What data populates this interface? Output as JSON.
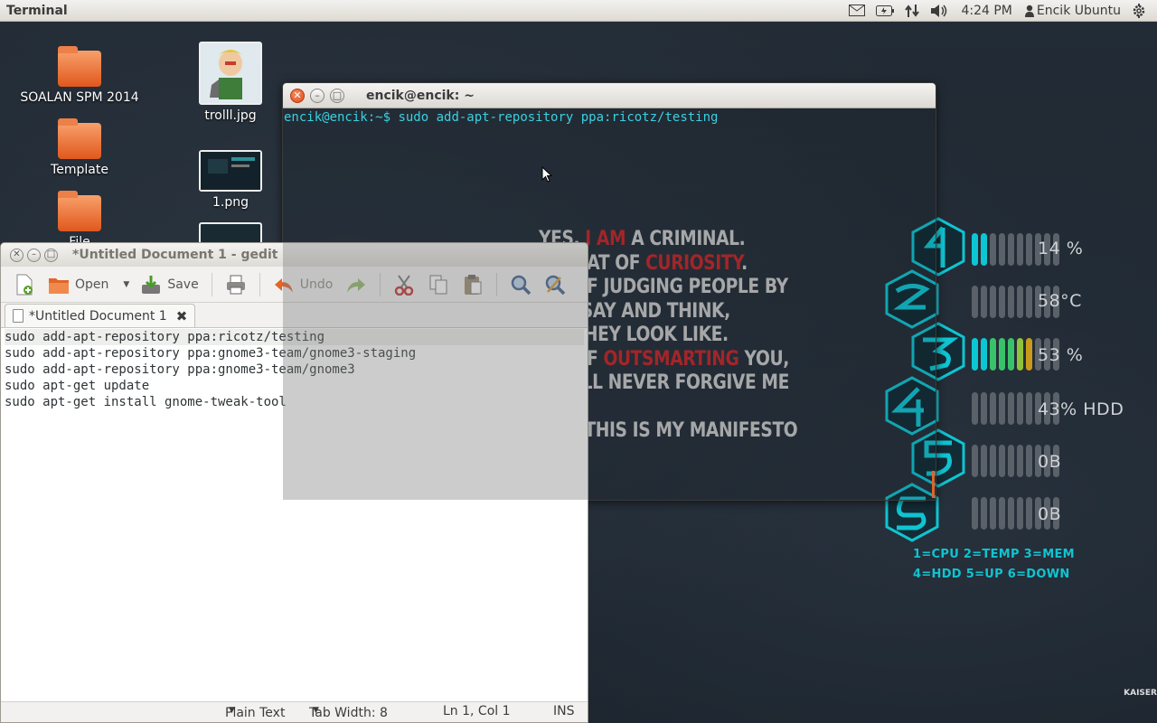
{
  "top_panel": {
    "app_name": "Terminal",
    "time": "4:24 PM",
    "user": "Encik Ubuntu"
  },
  "desktop": {
    "icons": [
      {
        "label": "SOALAN SPM 2014",
        "kind": "folder"
      },
      {
        "label": "Template",
        "kind": "folder"
      },
      {
        "label": "File",
        "kind": "folder"
      },
      {
        "label": "trolll.jpg",
        "kind": "image"
      },
      {
        "label": "1.png",
        "kind": "image"
      }
    ],
    "wallpaper_lines": [
      {
        "pre": "YES, ",
        "red": "I AM",
        "post": " A CRIMINAL."
      },
      {
        "pre": "IS THAT OF ",
        "red": "CURIOSITY",
        "post": "."
      },
      {
        "pre": "IAT OF JUDGING PEOPLE BY",
        "red": "",
        "post": ""
      },
      {
        "pre": "HEY SAY AND THINK,",
        "red": "",
        "post": ""
      },
      {
        "pre": "IAT THEY LOOK LIKE.",
        "red": "",
        "post": ""
      },
      {
        "pre": "IAT OF ",
        "red": "OUTSMARTING",
        "post": " YOU,"
      },
      {
        "pre": "U WILL NEVER FORGIVE ME FOR.",
        "red": "",
        "post": ""
      },
      {
        "pre": "",
        "red": "",
        "post": ""
      },
      {
        "pre": "AND THIS IS MY MANIFESTO",
        "red": "",
        "post": ""
      }
    ],
    "corner_mark": "KAISER"
  },
  "conky": {
    "rows": [
      {
        "glyph": "1",
        "value": "14 %",
        "filled": 2,
        "color": "#0cc7d3"
      },
      {
        "glyph": "2",
        "value": "58°C",
        "filled": 0,
        "color": "#5b6169"
      },
      {
        "glyph": "3",
        "value": "53 %",
        "filled": 7,
        "color": "#3ac26a"
      },
      {
        "glyph": "4",
        "value": "43% HDD",
        "filled": 0,
        "color": "#5b6169"
      },
      {
        "glyph": "5",
        "value": "0B",
        "filled": 0,
        "color": "#5b6169"
      },
      {
        "glyph": "6",
        "value": "0B",
        "filled": 0,
        "color": "#5b6169"
      }
    ],
    "legend_line1": "1=CPU 2=TEMP 3=MEM",
    "legend_line2": "4=HDD 5=UP 6=DOWN",
    "accent": "#10c4d1"
  },
  "terminal": {
    "title": "encik@encik: ~",
    "prompt": "encik@encik:~$",
    "command": "sudo add-apt-repository ppa:ricotz/testing"
  },
  "gedit": {
    "title": "*Untitled Document 1 - gedit",
    "toolbar": {
      "open": "Open",
      "save": "Save",
      "undo": "Undo"
    },
    "tab_label": "*Untitled Document 1",
    "lines": [
      "sudo add-apt-repository ppa:ricotz/testing",
      "sudo add-apt-repository ppa:gnome3-team/gnome3-staging",
      "sudo add-apt-repository ppa:gnome3-team/gnome3",
      "sudo apt-get update",
      "sudo apt-get install gnome-tweak-tool"
    ],
    "status": {
      "language": "Plain Text",
      "tab_width": "Tab Width:  8",
      "position": "Ln 1, Col 1",
      "mode": "INS"
    }
  }
}
